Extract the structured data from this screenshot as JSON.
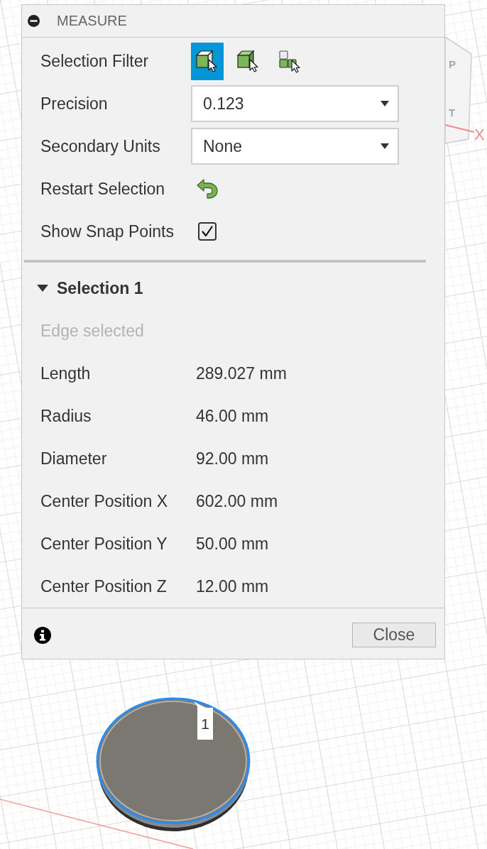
{
  "panel": {
    "title": "MEASURE"
  },
  "settings": [
    {
      "kind": "filter",
      "label": "Selection Filter",
      "options": [
        {
          "selected": true
        },
        {
          "selected": false
        },
        {
          "selected": false
        }
      ]
    },
    {
      "kind": "dropdown",
      "label": "Precision",
      "value": "0.123"
    },
    {
      "kind": "dropdown",
      "label": "Secondary Units",
      "value": "None"
    },
    {
      "kind": "action",
      "label": "Restart Selection"
    },
    {
      "kind": "checkbox",
      "label": "Show Snap Points",
      "checked": true
    }
  ],
  "selection": {
    "title": "Selection 1",
    "expanded": true,
    "status": "Edge selected",
    "properties": [
      {
        "label": "Length",
        "value": "289.027 mm"
      },
      {
        "label": "Radius",
        "value": "46.00 mm"
      },
      {
        "label": "Diameter",
        "value": "92.00 mm"
      },
      {
        "label": "Center Position X",
        "value": "602.00 mm"
      },
      {
        "label": "Center Position Y",
        "value": "50.00 mm"
      },
      {
        "label": "Center Position Z",
        "value": "12.00 mm"
      }
    ]
  },
  "footer": {
    "close_button": "Close"
  },
  "viewport": {
    "viewcube_labels": [
      "P",
      "T"
    ],
    "axis_label": "X",
    "marker": "1"
  }
}
